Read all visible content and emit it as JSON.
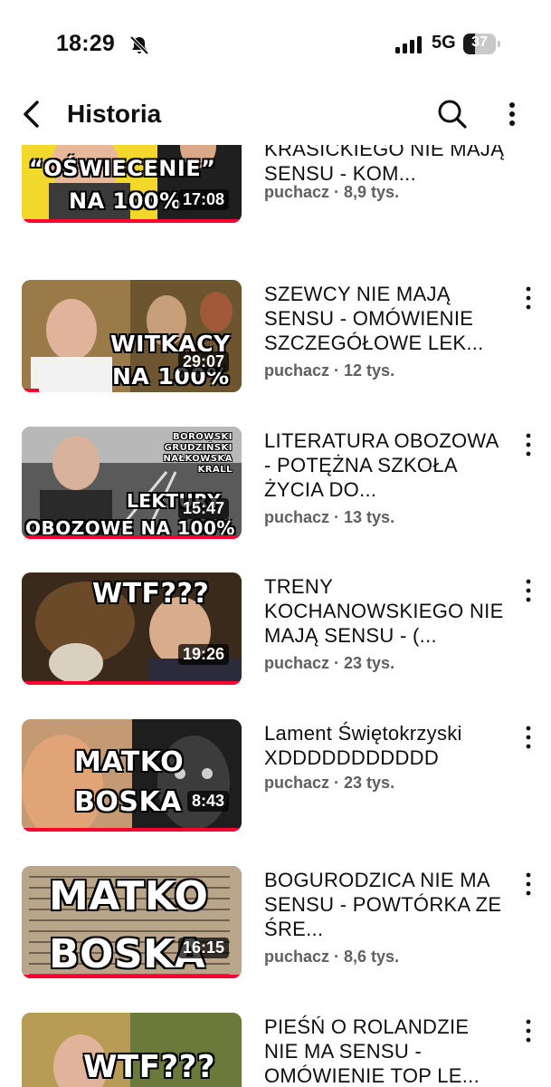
{
  "status_bar": {
    "time": "18:29",
    "network": "5G",
    "battery_level": "37"
  },
  "header": {
    "title": "Historia"
  },
  "items": [
    {
      "title": "BAJKI I SATYRY KRASICKIEGO NIE MAJĄ SENSU - KOM...",
      "channel": "puchacz",
      "views": "8,9 tys.",
      "duration": "17:08",
      "thumb_line1": "“OŚWIECENIE”",
      "thumb_line2": "NA 100%",
      "progress_fraction": 1.0
    },
    {
      "title": "SZEWCY NIE MAJĄ SENSU - OMÓWIENIE SZCZEGÓŁOWE LEK...",
      "channel": "puchacz",
      "views": "12 tys.",
      "duration": "29:07",
      "thumb_line1": "WITKACY",
      "thumb_line2": "NA 100%",
      "progress_fraction": 0.08
    },
    {
      "title": "LITERATURA OBOZOWA - POTĘŻNA SZKOŁA ŻYCIA DO...",
      "channel": "puchacz",
      "views": "13 tys.",
      "duration": "15:47",
      "thumb_names": [
        "BOROWSKI",
        "GRUDZIŃSKI",
        "NAŁKOWSKA",
        "KRALL"
      ],
      "thumb_line1": "LEKTURY",
      "thumb_line2": "OBOZOWE NA 100%",
      "progress_fraction": 1.0
    },
    {
      "title": "TRENY KOCHANOWSKIEGO NIE MAJĄ SENSU - (...",
      "channel": "puchacz",
      "views": "23 tys.",
      "duration": "19:26",
      "thumb_line1": "WTF???",
      "progress_fraction": 1.0
    },
    {
      "title": "Lament Świętokrzyski XDDDDDDDDDDD",
      "channel": "puchacz",
      "views": "23 tys.",
      "duration": "8:43",
      "thumb_line1": "MATKO",
      "thumb_line2": "BOSKA",
      "progress_fraction": 1.0
    },
    {
      "title": "BOGURODZICA NIE MA SENSU - POWTÓRKA ZE ŚRE...",
      "channel": "puchacz",
      "views": "8,6 tys.",
      "duration": "16:15",
      "thumb_line1": "MATKO",
      "thumb_line2": "BOSKA",
      "progress_fraction": 1.0
    },
    {
      "title": "PIEŚŃ O ROLANDZIE NIE MA SENSU - OMÓWIENIE TOP LE...",
      "channel": "puchacz",
      "views": "",
      "duration": "",
      "thumb_line1": "WTF???",
      "progress_fraction": 0
    }
  ],
  "colors": {
    "progress": "#ff0033",
    "meta_text": "#606060",
    "title_text": "#0f0f0f"
  },
  "icons": [
    "bell-off-icon",
    "signal-icon",
    "battery-icon",
    "back-arrow-icon",
    "search-icon",
    "more-vertical-icon"
  ]
}
